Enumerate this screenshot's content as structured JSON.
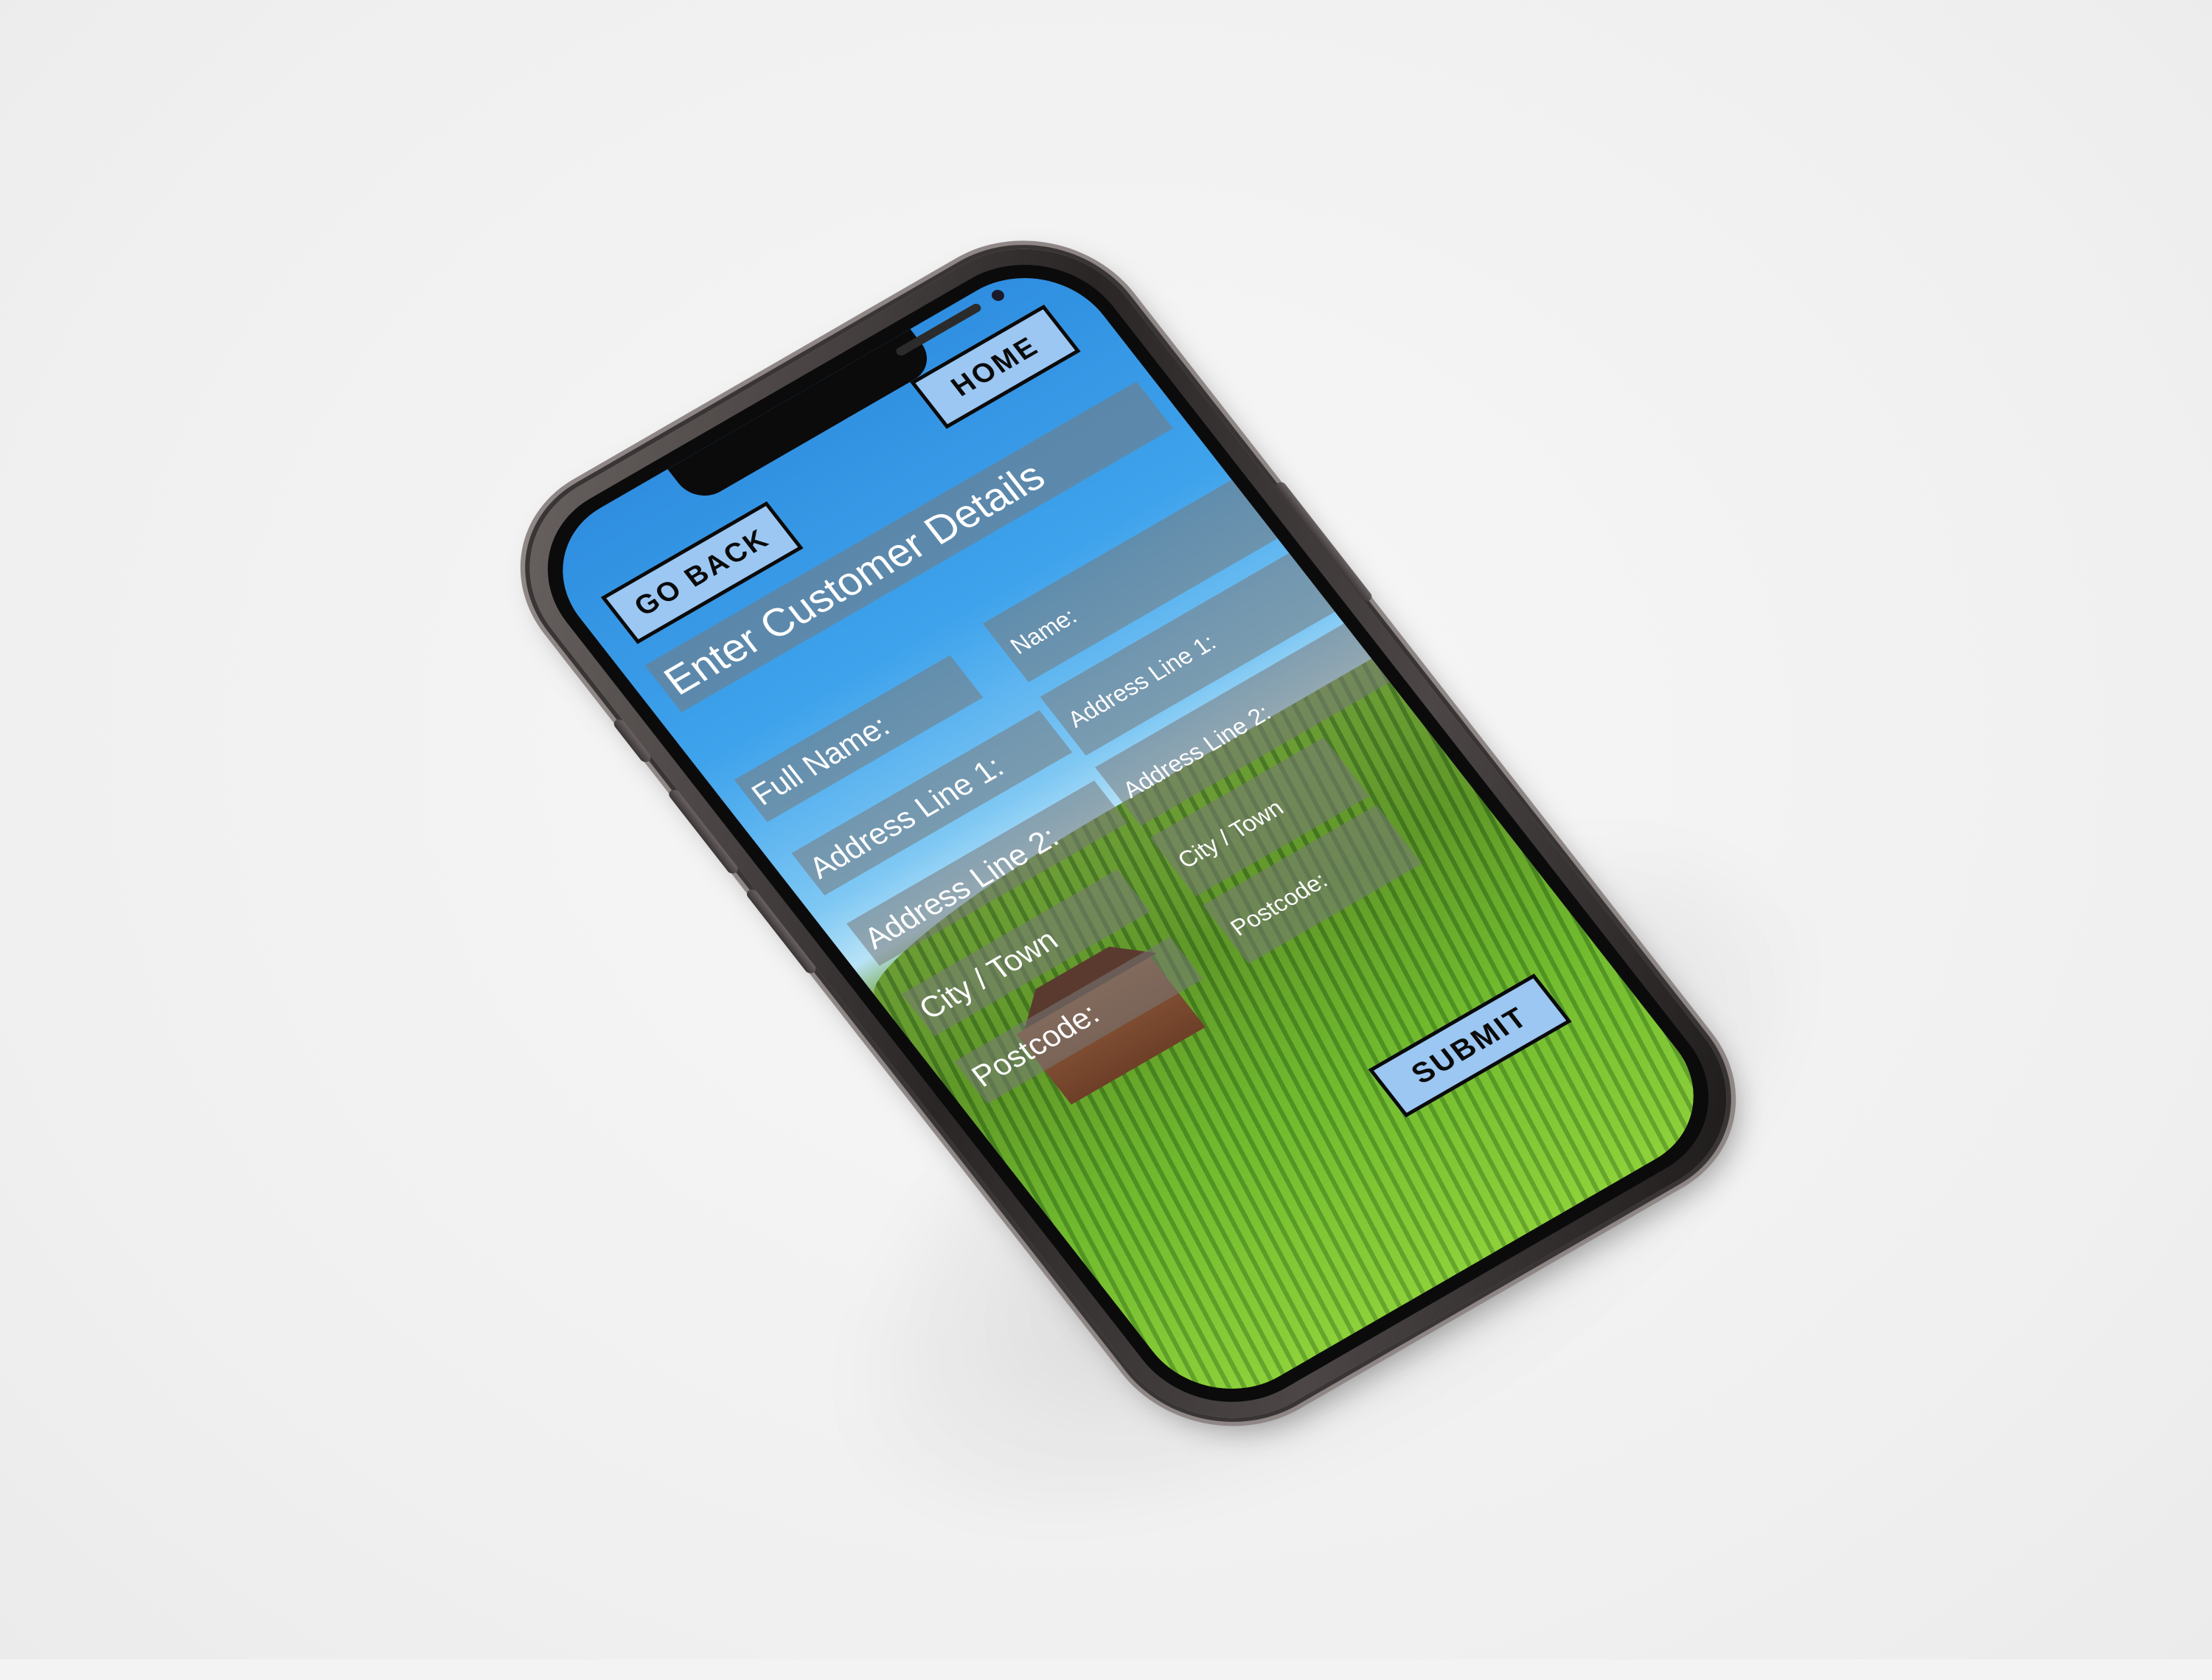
{
  "navigation": {
    "back_label": "GO BACK",
    "home_label": "HOME"
  },
  "form": {
    "title": "Enter Customer Details",
    "fields": [
      {
        "label": "Full Name:",
        "placeholder": "Name:"
      },
      {
        "label": "Address Line 1:",
        "placeholder": "Address Line 1:"
      },
      {
        "label": "Address Line 2:",
        "placeholder": "Address Line 2:"
      },
      {
        "label": "City / Town",
        "placeholder": "City / Town"
      },
      {
        "label": "Postcode:",
        "placeholder": "Postcode:"
      }
    ],
    "submit_label": "SUBMIT"
  },
  "colors": {
    "button_fill": "#9cc7f2",
    "button_border": "#0a0a0a",
    "panel_fill": "rgba(120,120,120,0.55)",
    "sky": "#3fa3ec",
    "grass": "#6bbf2c",
    "device_frame": "#2a2626"
  }
}
